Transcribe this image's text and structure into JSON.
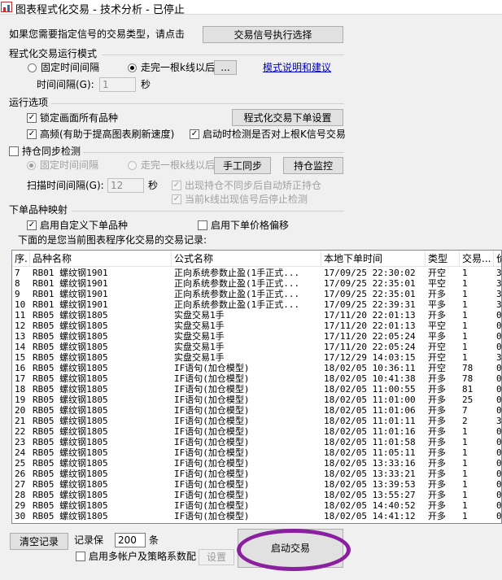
{
  "window": {
    "title": "图表程式化交易 - 技术分析 - 已停止"
  },
  "signal": {
    "prompt": "如果您需要指定信号的交易类型，请点击",
    "button_label": "交易信号执行选择"
  },
  "run_mode": {
    "header": "程式化交易运行模式",
    "fixed_interval_label": "固定时间间隔",
    "after_bar_label": "走完一根k线以后",
    "selected": "after_bar",
    "ellipsis_label": "...",
    "help_link": "模式说明和建议",
    "interval_label": "时间间隔(G):",
    "interval_value": "1",
    "interval_unit": "秒"
  },
  "options": {
    "header": "运行选项",
    "lock_symbol_label": "锁定画面所有品种",
    "lock_symbol_checked": true,
    "order_settings_button": "程式化交易下单设置",
    "high_freq_label": "高频(有助于提高图表刷新速度)",
    "high_freq_checked": true,
    "check_prev_bar_label": "启动时检测是否对上根K信号交易",
    "check_prev_bar_checked": true
  },
  "position_sync": {
    "header_label": "持仓同步检测",
    "checked": false,
    "fixed_interval_label": "固定时间间隔",
    "after_bar_label": "走完一根k线以后",
    "manual_sync_button": "手工同步",
    "monitor_button": "持仓监控",
    "scan_label": "扫描时间间隔(G):",
    "scan_value": "12",
    "scan_unit": "秒",
    "auto_correct_label": "出现持仓不同步后自动矫正持仓",
    "auto_correct_checked": true,
    "stop_detect_label": "当前k线出现信号后停止检测",
    "stop_detect_checked": true
  },
  "mapping": {
    "header": "下单品种映射",
    "custom_symbol_label": "启用自定义下单品种",
    "custom_symbol_checked": true,
    "price_offset_label": "启用下单价格偏移",
    "price_offset_checked": false
  },
  "records": {
    "caption": "下面的是您当前图表程序化交易的交易记录:",
    "columns": [
      "序.",
      "品种名称",
      "公式名称",
      "本地下单时间",
      "类型",
      "交易...",
      "价"
    ],
    "rows": [
      [
        "7",
        "RB01 螺纹钢1901",
        "正向系统参数止盈(1手正式...",
        "17/09/25 22:30:02",
        "开空",
        "1",
        "3"
      ],
      [
        "8",
        "RB01 螺纹钢1901",
        "正向系统参数止盈(1手正式...",
        "17/09/25 22:35:01",
        "平空",
        "1",
        "3"
      ],
      [
        "9",
        "RB01 螺纹钢1901",
        "正向系统参数止盈(1手正式...",
        "17/09/25 22:35:01",
        "开多",
        "1",
        "3"
      ],
      [
        "10",
        "RB01 螺纹钢1901",
        "正向系统参数止盈(1手正式...",
        "17/09/25 22:39:31",
        "平多",
        "1",
        "3"
      ],
      [
        "11",
        "RB05 螺纹钢1805",
        "实盘交易1手",
        "17/11/20 22:01:13",
        "开多",
        "1",
        "0"
      ],
      [
        "12",
        "RB05 螺纹钢1805",
        "实盘交易1手",
        "17/11/20 22:01:13",
        "平空",
        "1",
        "0"
      ],
      [
        "13",
        "RB05 螺纹钢1805",
        "实盘交易1手",
        "17/11/20 22:05:24",
        "平多",
        "1",
        "0"
      ],
      [
        "14",
        "RB05 螺纹钢1805",
        "实盘交易1手",
        "17/11/20 22:05:24",
        "开空",
        "1",
        "0"
      ],
      [
        "15",
        "RB05 螺纹钢1805",
        "实盘交易1手",
        "17/12/29 14:03:15",
        "开空",
        "1",
        "3"
      ],
      [
        "16",
        "RB05 螺纹钢1805",
        "IF语句(加仓模型)",
        "18/02/05 10:36:11",
        "开空",
        "78",
        "0"
      ],
      [
        "17",
        "RB05 螺纹钢1805",
        "IF语句(加仓模型)",
        "18/02/05 10:41:38",
        "开多",
        "78",
        "0"
      ],
      [
        "18",
        "RB05 螺纹钢1805",
        "IF语句(加仓模型)",
        "18/02/05 11:00:55",
        "开多",
        "81",
        "0"
      ],
      [
        "19",
        "RB05 螺纹钢1805",
        "IF语句(加仓模型)",
        "18/02/05 11:01:00",
        "开多",
        "25",
        "0"
      ],
      [
        "20",
        "RB05 螺纹钢1805",
        "IF语句(加仓模型)",
        "18/02/05 11:01:06",
        "开多",
        "7",
        "0"
      ],
      [
        "21",
        "RB05 螺纹钢1805",
        "IF语句(加仓模型)",
        "18/02/05 11:01:11",
        "开多",
        "2",
        "3"
      ],
      [
        "22",
        "RB05 螺纹钢1805",
        "IF语句(加仓模型)",
        "18/02/05 11:01:16",
        "开多",
        "1",
        "0"
      ],
      [
        "23",
        "RB05 螺纹钢1805",
        "IF语句(加仓模型)",
        "18/02/05 11:01:58",
        "开多",
        "1",
        "0"
      ],
      [
        "24",
        "RB05 螺纹钢1805",
        "IF语句(加仓模型)",
        "18/02/05 11:05:11",
        "开多",
        "1",
        "0"
      ],
      [
        "25",
        "RB05 螺纹钢1805",
        "IF语句(加仓模型)",
        "18/02/05 13:33:16",
        "开多",
        "1",
        "0"
      ],
      [
        "26",
        "RB05 螺纹钢1805",
        "IF语句(加仓模型)",
        "18/02/05 13:33:21",
        "开多",
        "1",
        "0"
      ],
      [
        "27",
        "RB05 螺纹钢1805",
        "IF语句(加仓模型)",
        "18/02/05 13:39:53",
        "开多",
        "1",
        "0"
      ],
      [
        "28",
        "RB05 螺纹钢1805",
        "IF语句(加仓模型)",
        "18/02/05 13:55:27",
        "开多",
        "1",
        "0"
      ],
      [
        "29",
        "RB05 螺纹钢1805",
        "IF语句(加仓模型)",
        "18/02/05 14:40:52",
        "开多",
        "1",
        "0"
      ],
      [
        "30",
        "RB05 螺纹钢1805",
        "IF语句(加仓模型)",
        "18/02/05 14:41:12",
        "开多",
        "1",
        "0"
      ]
    ]
  },
  "footer": {
    "clear_button": "清空记录",
    "keep_label": "记录保",
    "keep_value": "200",
    "keep_unit": "条",
    "multi_account_label": "启用多帐户及策略系数配",
    "multi_account_checked": false,
    "settings_button": "设置",
    "start_button": "启动交易"
  },
  "colors": {
    "highlight_ring": "#8a1fa0",
    "link": "#0000cc"
  }
}
